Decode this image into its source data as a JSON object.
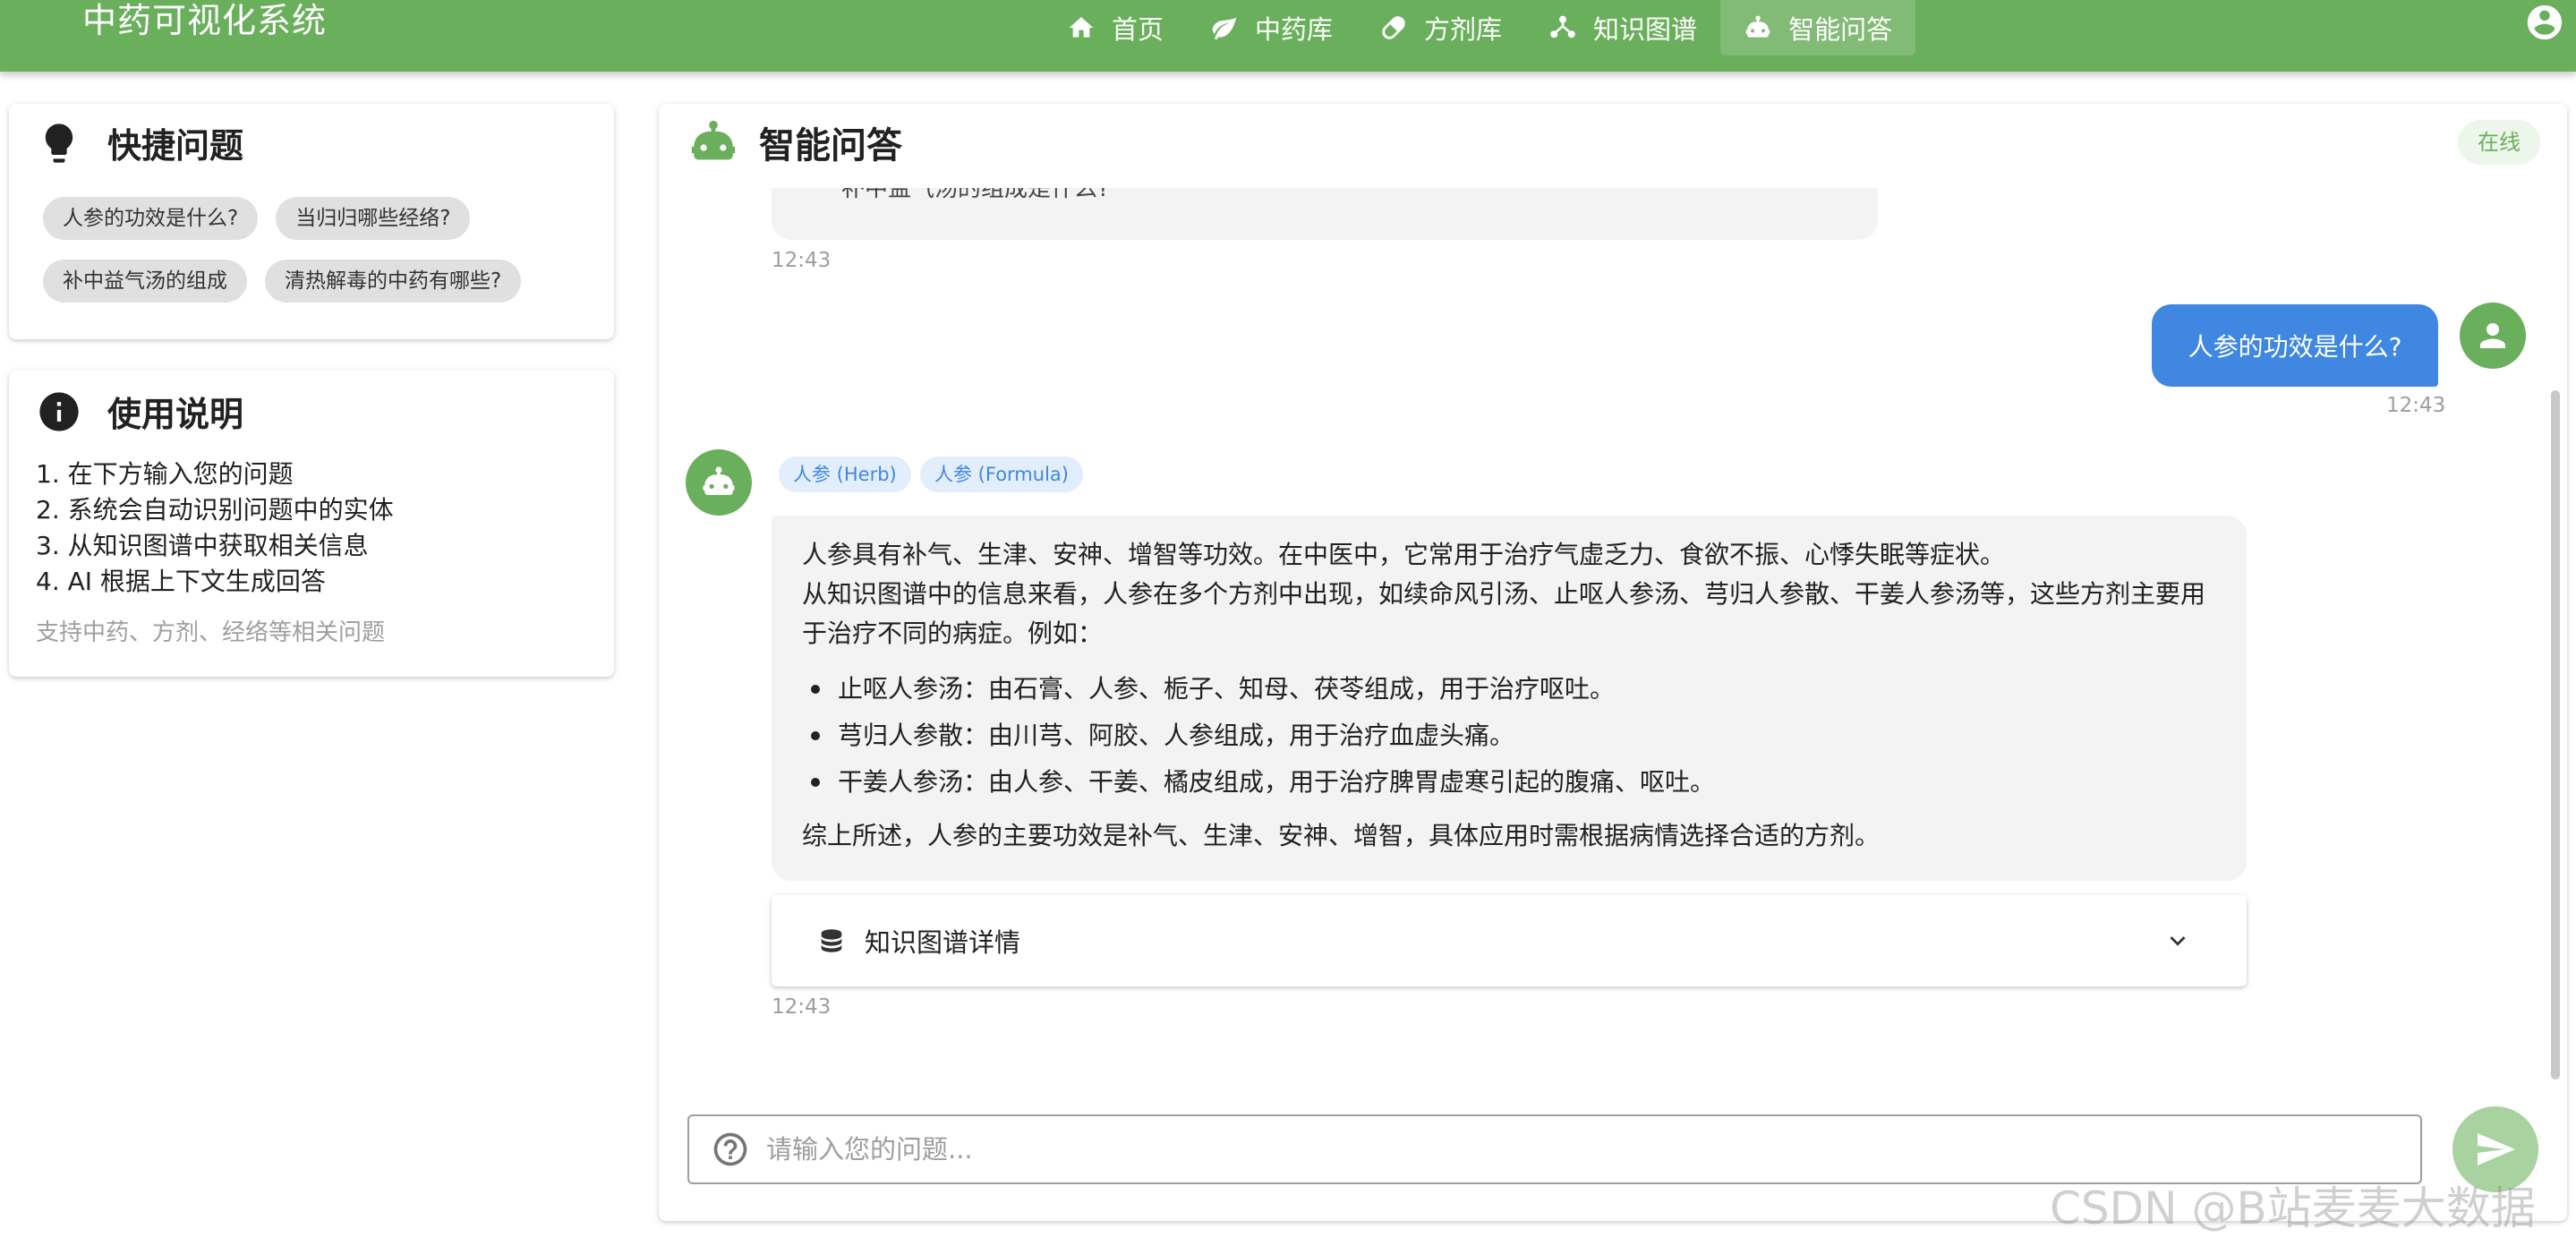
{
  "app": {
    "title": "中药可视化系统"
  },
  "nav": [
    {
      "label": "首页",
      "icon": "home-icon"
    },
    {
      "label": "中药库",
      "icon": "leaf-icon"
    },
    {
      "label": "方剂库",
      "icon": "pill-icon"
    },
    {
      "label": "知识图谱",
      "icon": "graph-icon"
    },
    {
      "label": "智能问答",
      "icon": "robot-icon",
      "active": true
    }
  ],
  "quick": {
    "title": "快捷问题",
    "chips": [
      "人参的功效是什么?",
      "当归归哪些经络?",
      "补中益气汤的组成",
      "清热解毒的中药有哪些?"
    ]
  },
  "guide": {
    "title": "使用说明",
    "steps": [
      "1. 在下方输入您的问题",
      "2. 系统会自动识别问题中的实体",
      "3. 从知识图谱中获取相关信息",
      "4. AI 根据上下文生成回答"
    ],
    "hint": "支持中药、方剂、经络等相关问题"
  },
  "chat": {
    "title": "智能问答",
    "status": "在线",
    "prev_fragment": "补中益气汤的组成是什么?",
    "prev_time": "12:43",
    "user_message": "人参的功效是什么?",
    "user_time": "12:43",
    "tags": [
      "人参 (Herb)",
      "人参 (Formula)"
    ],
    "answer": {
      "intro": "人参具有补气、生津、安神、增智等功效。在中医中，它常用于治疗气虚乏力、食欲不振、心悸失眠等症状。",
      "para": "从知识图谱中的信息来看，人参在多个方剂中出现，如续命风引汤、止呕人参汤、芎归人参散、干姜人参汤等，这些方剂主要用于治疗不同的病症。例如：",
      "items": [
        "止呕人参汤：由石膏、人参、栀子、知母、茯苓组成，用于治疗呕吐。",
        "芎归人参散：由川芎、阿胶、人参组成，用于治疗血虚头痛。",
        "干姜人参汤：由人参、干姜、橘皮组成，用于治疗脾胃虚寒引起的腹痛、呕吐。"
      ],
      "summary": "综上所述，人参的主要功效是补气、生津、安神、增智，具体应用时需根据病情选择合适的方剂。"
    },
    "kg_label": "知识图谱详情",
    "bot_time": "12:43",
    "input_placeholder": "请输入您的问题..."
  },
  "watermark": "CSDN @B站麦麦大数据",
  "colors": {
    "primary": "#6aaf5c",
    "user_bubble": "#3f87e0",
    "tag_text": "#3f87e0"
  }
}
